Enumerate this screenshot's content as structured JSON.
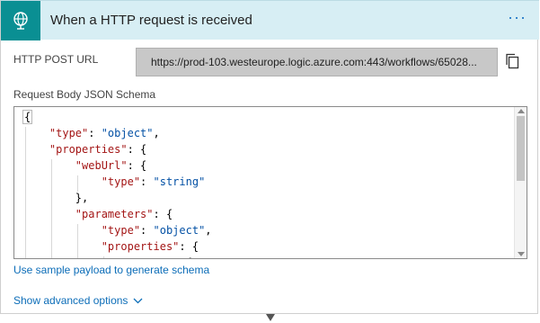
{
  "header": {
    "title": "When a HTTP request is received",
    "more_label": "···",
    "icon": "globe-request-icon"
  },
  "url_field": {
    "label": "HTTP POST URL",
    "value": "https://prod-103.westeurope.logic.azure.com:443/workflows/65028...",
    "copy_icon": "copy-icon"
  },
  "schema": {
    "label": "Request Body JSON Schema",
    "lines": [
      [
        {
          "t": "{",
          "c": "p"
        }
      ],
      [
        {
          "t": "    \"type\"",
          "c": "k"
        },
        {
          "t": ": ",
          "c": "p"
        },
        {
          "t": "\"object\"",
          "c": "s"
        },
        {
          "t": ",",
          "c": "p"
        }
      ],
      [
        {
          "t": "    \"properties\"",
          "c": "k"
        },
        {
          "t": ": {",
          "c": "p"
        }
      ],
      [
        {
          "t": "        \"webUrl\"",
          "c": "k"
        },
        {
          "t": ": {",
          "c": "p"
        }
      ],
      [
        {
          "t": "            \"type\"",
          "c": "k"
        },
        {
          "t": ": ",
          "c": "p"
        },
        {
          "t": "\"string\"",
          "c": "s"
        }
      ],
      [
        {
          "t": "        },",
          "c": "p"
        }
      ],
      [
        {
          "t": "        \"parameters\"",
          "c": "k"
        },
        {
          "t": ": {",
          "c": "p"
        }
      ],
      [
        {
          "t": "            \"type\"",
          "c": "k"
        },
        {
          "t": ": ",
          "c": "p"
        },
        {
          "t": "\"object\"",
          "c": "s"
        },
        {
          "t": ",",
          "c": "p"
        }
      ],
      [
        {
          "t": "            \"properties\"",
          "c": "k"
        },
        {
          "t": ": {",
          "c": "p"
        }
      ],
      [
        {
          "t": "                \"event\"",
          "c": "k"
        },
        {
          "t": ": {",
          "c": "p"
        }
      ]
    ]
  },
  "links": {
    "sample_payload": "Use sample payload to generate schema",
    "advanced": "Show advanced options"
  },
  "colors": {
    "header_bg": "#d7eef4",
    "icon_bg": "#0a8f93",
    "link": "#0c6db8",
    "json_key": "#a31515",
    "json_string": "#0451a5"
  }
}
